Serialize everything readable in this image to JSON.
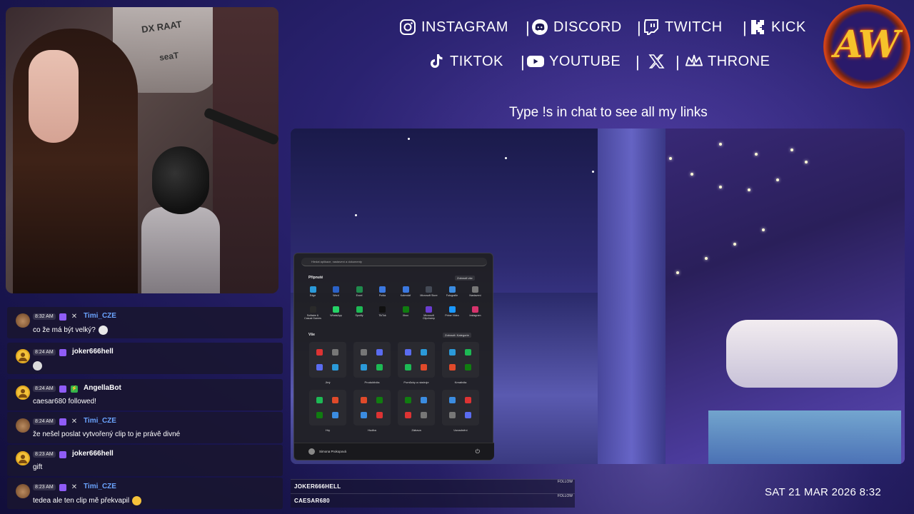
{
  "socials": {
    "instagram": "INSTAGRAM",
    "discord": "DISCORD",
    "twitch": "TWITCH",
    "kick": "KICK",
    "tiktok": "TIKTOK",
    "youtube": "YOUTUBE",
    "x": "",
    "throne": "THRONE"
  },
  "separator": "|",
  "logo_text": "AW",
  "links_hint": "Type !s in chat to see all my links",
  "webcam": {
    "chair_text_1": "DX RAAT",
    "chair_text_2": "seaT"
  },
  "start_menu": {
    "search_placeholder": "Hledat aplikace, nastavení a dokumenty",
    "pinned_title": "Připnuté",
    "see_all": "Zobrazit vše",
    "all_title": "Vše",
    "show_categories": "Zobrazit: Kategorie",
    "pinned_apps": [
      {
        "label": "Edge",
        "color": "#2b9ad9"
      },
      {
        "label": "Word",
        "color": "#2b62c8"
      },
      {
        "label": "Excel",
        "color": "#1f8a4c"
      },
      {
        "label": "Pošta",
        "color": "#3b78e0"
      },
      {
        "label": "Kalendář",
        "color": "#3b78e0"
      },
      {
        "label": "Microsoft Store",
        "color": "#444a55"
      },
      {
        "label": "Fotografie",
        "color": "#3b8ce0"
      },
      {
        "label": "Nastavení",
        "color": "#777"
      },
      {
        "label": "Solitaire & Casual Games",
        "color": "#2a2a2a"
      },
      {
        "label": "WhatsApp",
        "color": "#25d366"
      },
      {
        "label": "Spotify",
        "color": "#1db954"
      },
      {
        "label": "TikTok",
        "color": "#111"
      },
      {
        "label": "Xbox",
        "color": "#107c10"
      },
      {
        "label": "Microsoft Clipchamp",
        "color": "#6a3dd0"
      },
      {
        "label": "Prime Video",
        "color": "#1a98ff"
      },
      {
        "label": "Instagram",
        "color": "#d6336c"
      }
    ],
    "categories": [
      "Jiný",
      "Produktivita",
      "Pomůcky a nástroje",
      "Kreativita",
      "Hry",
      "Hudba",
      "Zábava",
      "Usnadnění"
    ],
    "user_name": "Simona Prokopová",
    "power_icon": "⏻"
  },
  "chat": [
    {
      "time": "8:32 AM",
      "user": "Timi_CZE",
      "user_color": "#6ba4ff",
      "avatar": "bear",
      "badges": [
        "twitch",
        "x"
      ],
      "text": "co že má být velký?",
      "emote": "skull"
    },
    {
      "time": "8:24 AM",
      "user": "joker666hell",
      "user_color": "#ffffff",
      "avatar": "gold",
      "badges": [
        "twitch"
      ],
      "text": "",
      "emote": "face"
    },
    {
      "time": "8:24 AM",
      "user": "AngellaBot",
      "user_color": "#ffffff",
      "avatar": "gold",
      "badges": [
        "twitch",
        "bot"
      ],
      "text": "caesar680 followed!",
      "emote": ""
    },
    {
      "time": "8:24 AM",
      "user": "Timi_CZE",
      "user_color": "#6ba4ff",
      "avatar": "bear",
      "badges": [
        "twitch",
        "x"
      ],
      "text": "že nešel poslat vytvořený clip to je právě divné",
      "emote": ""
    },
    {
      "time": "8:23 AM",
      "user": "joker666hell",
      "user_color": "#ffffff",
      "avatar": "gold",
      "badges": [
        "twitch"
      ],
      "text": "gift",
      "emote": ""
    },
    {
      "time": "8:23 AM",
      "user": "Timi_CZE",
      "user_color": "#6ba4ff",
      "avatar": "bear",
      "badges": [
        "twitch",
        "x"
      ],
      "text": "tedea ale ten clip mě překvapil",
      "emote": "thinking"
    }
  ],
  "followers": [
    {
      "name": "JOKER666HELL",
      "tag": "FOLLOW"
    },
    {
      "name": "CAESAR680",
      "tag": "FOLLOW"
    }
  ],
  "datetime": "SAT 21 MAR 2026 8:32",
  "colors": {
    "twitch": "#8f5cf6",
    "accent_blue": "#6ba4ff",
    "logo_gold": "#f6c22b",
    "logo_red": "#d6451a"
  }
}
